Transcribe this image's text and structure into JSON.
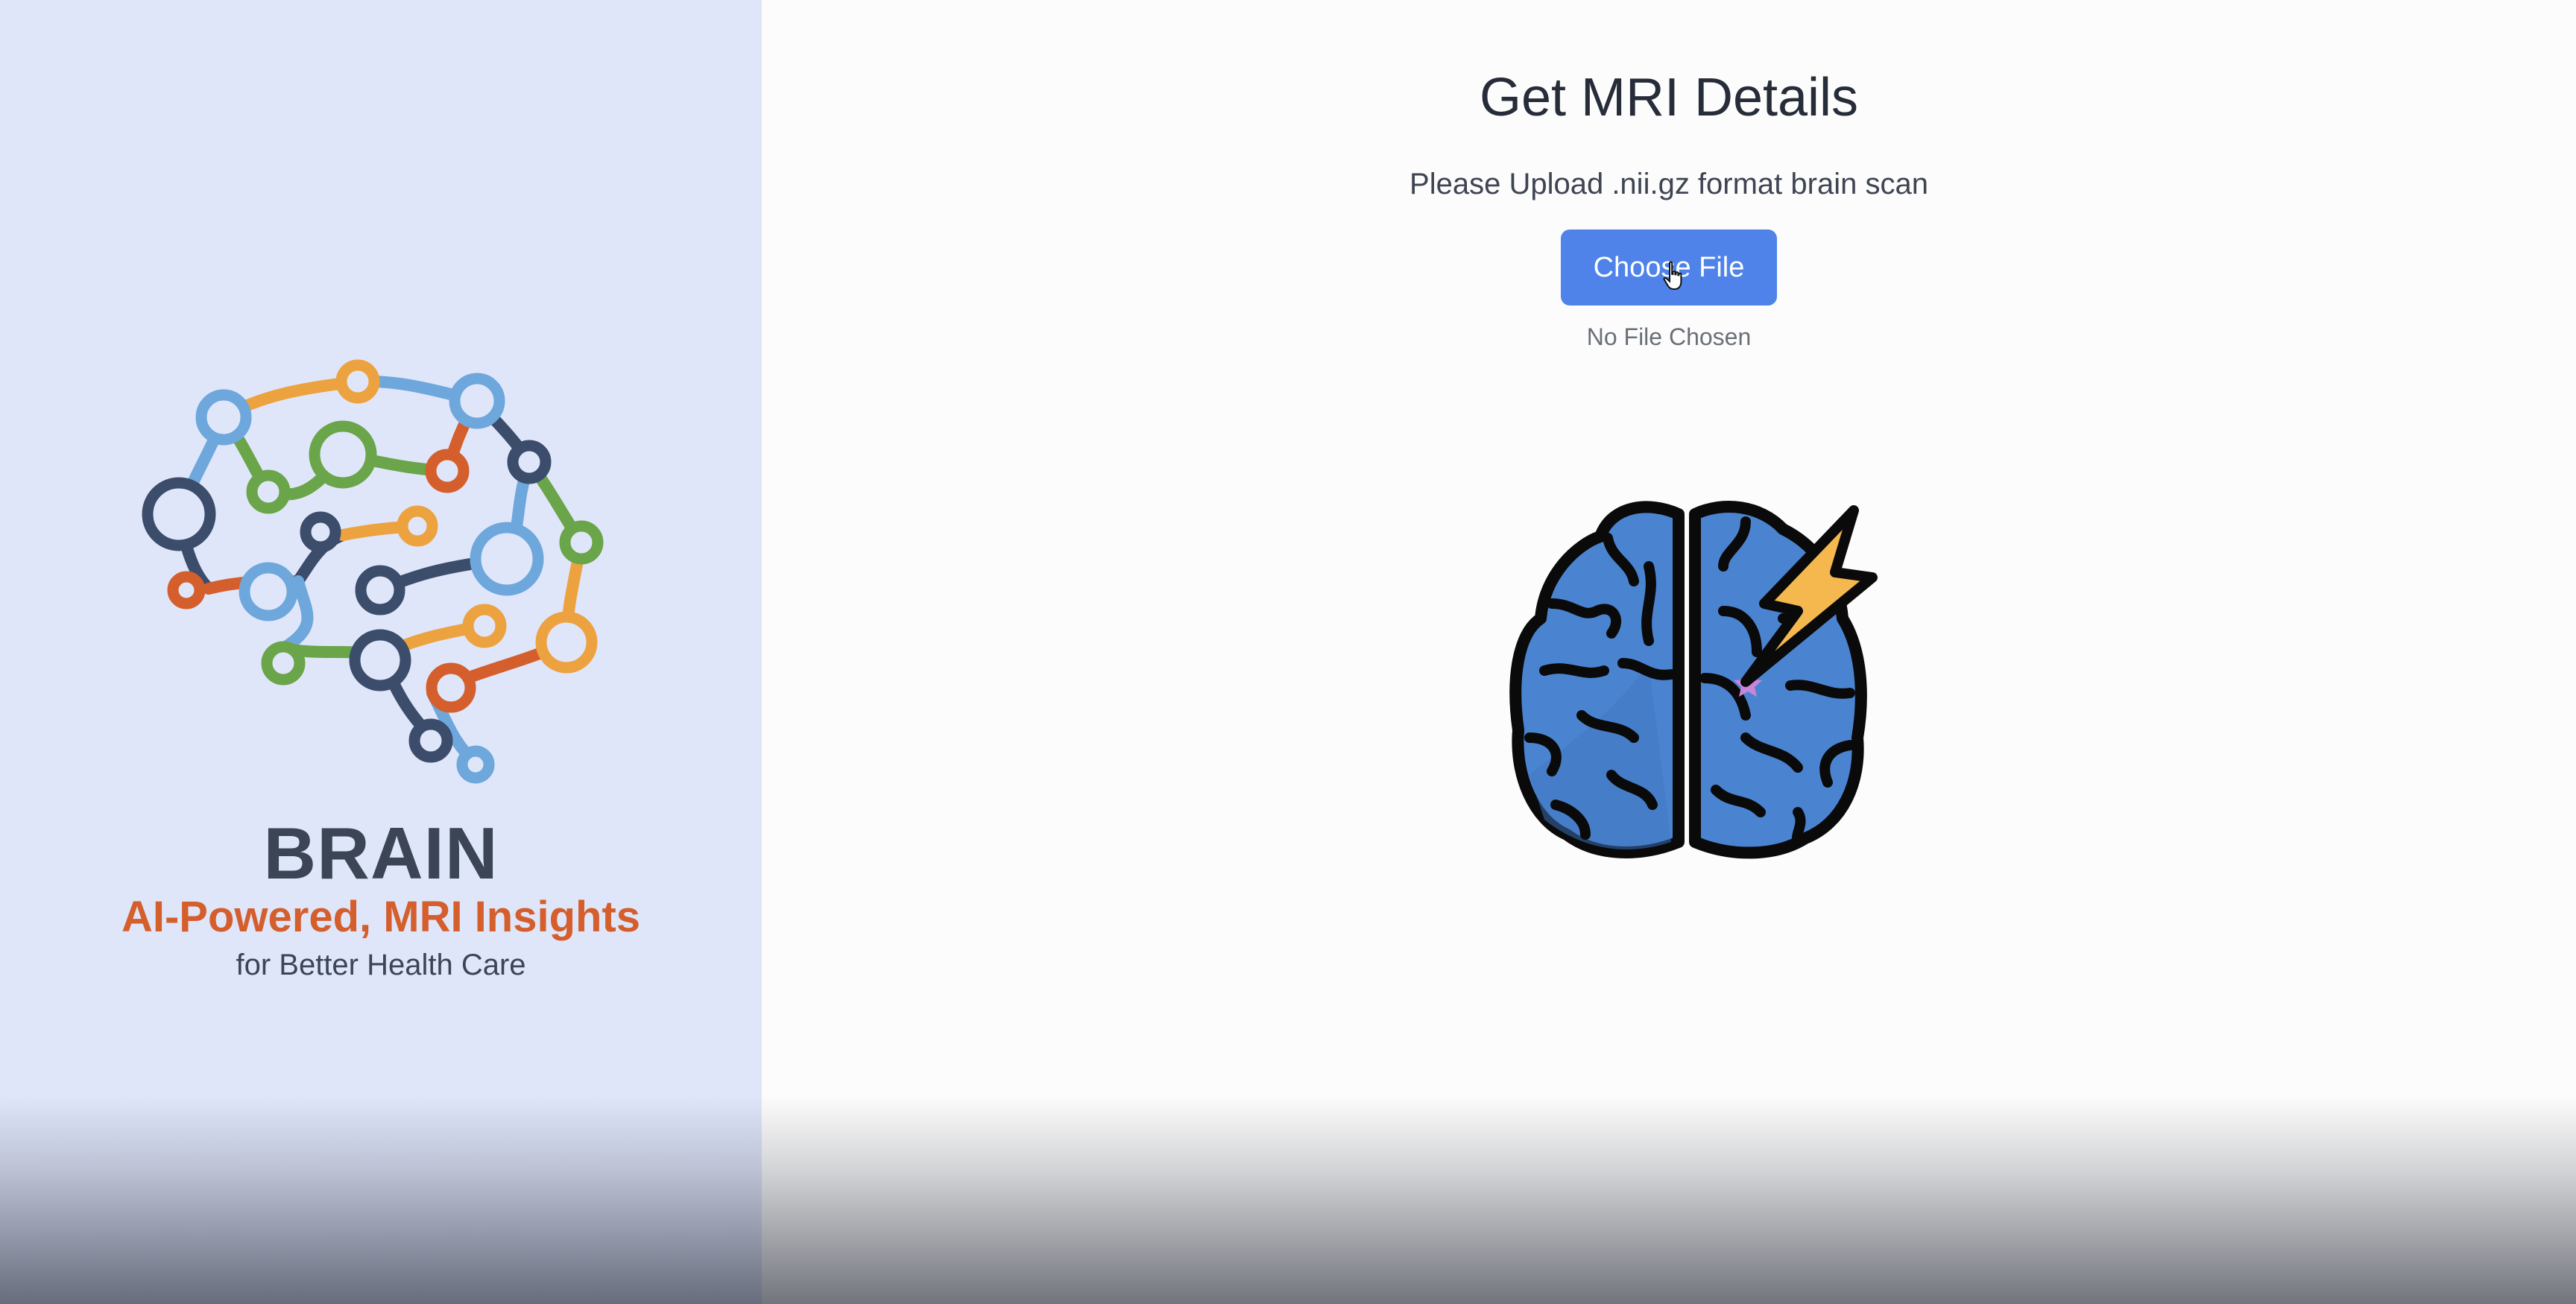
{
  "sidebar": {
    "logo_icon": "brain-network-logo",
    "brand_name": "BRAIN",
    "tagline": "AI-Powered, MRI Insights",
    "subtitle": "for Better Health Care"
  },
  "main": {
    "title": "Get MRI Details",
    "instruction": "Please Upload .nii.gz format brain scan",
    "choose_file_label": "Choose File",
    "file_status": "No File Chosen",
    "illustration_icon": "brain-lightning-icon"
  },
  "colors": {
    "sidebar_bg": "#e0e6fa",
    "accent_blue": "#4f83ea",
    "tagline_orange": "#d45f2d",
    "brand_dark": "#3b4556"
  }
}
